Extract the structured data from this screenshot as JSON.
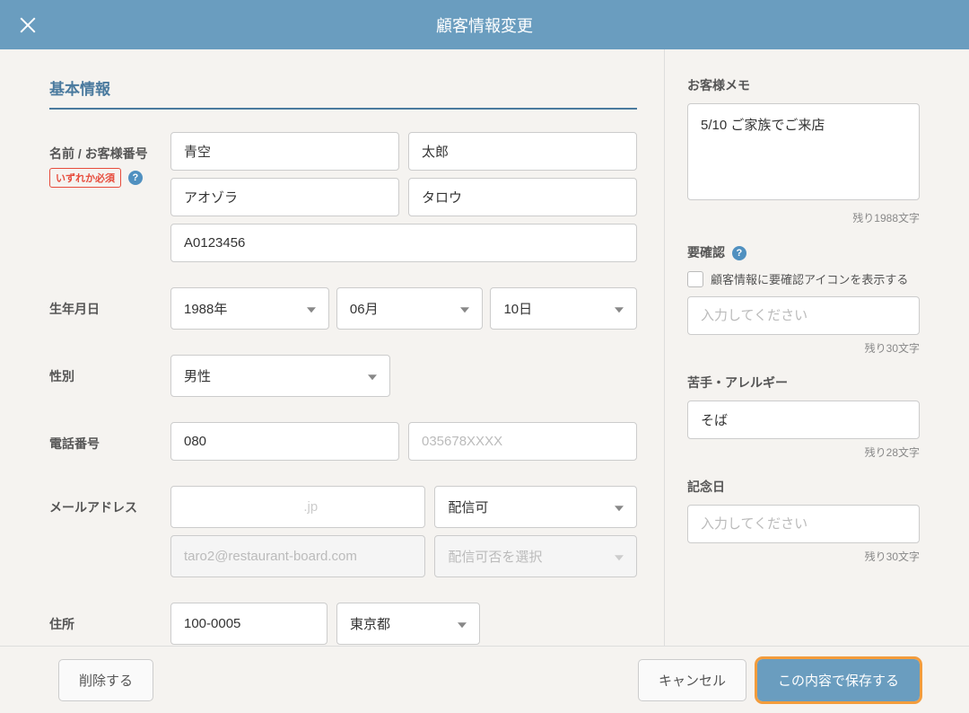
{
  "header": {
    "title": "顧客情報変更"
  },
  "section_title": "基本情報",
  "name": {
    "label": "名前 / お客様番号",
    "required_badge": "いずれか必須",
    "surname": "青空",
    "given": "太郎",
    "surname_kana": "アオゾラ",
    "given_kana": "タロウ",
    "customer_no": "A0123456"
  },
  "birth": {
    "label": "生年月日",
    "year": "1988年",
    "month": "06月",
    "day": "10日"
  },
  "gender": {
    "label": "性別",
    "value": "男性"
  },
  "phone": {
    "label": "電話番号",
    "value1": "080",
    "placeholder2": "035678XXXX"
  },
  "email": {
    "label": "メールアドレス",
    "value1": "                                .jp",
    "delivery1": "配信可",
    "placeholder2": "taro2@restaurant-board.com",
    "delivery2": "配信可否を選択"
  },
  "address": {
    "label": "住所",
    "zip": "100-0005",
    "pref": "東京都"
  },
  "memo": {
    "label": "お客様メモ",
    "value": "5/10 ご家族でご来店",
    "count": "残り1988文字"
  },
  "confirm": {
    "label": "要確認",
    "checkbox_label": "顧客情報に要確認アイコンを表示する",
    "placeholder": "入力してください",
    "count": "残り30文字"
  },
  "allergy": {
    "label": "苦手・アレルギー",
    "value": "そば",
    "count": "残り28文字"
  },
  "anniversary": {
    "label": "記念日",
    "placeholder": "入力してください",
    "count": "残り30文字"
  },
  "footer": {
    "delete": "削除する",
    "cancel": "キャンセル",
    "save": "この内容で保存する"
  }
}
